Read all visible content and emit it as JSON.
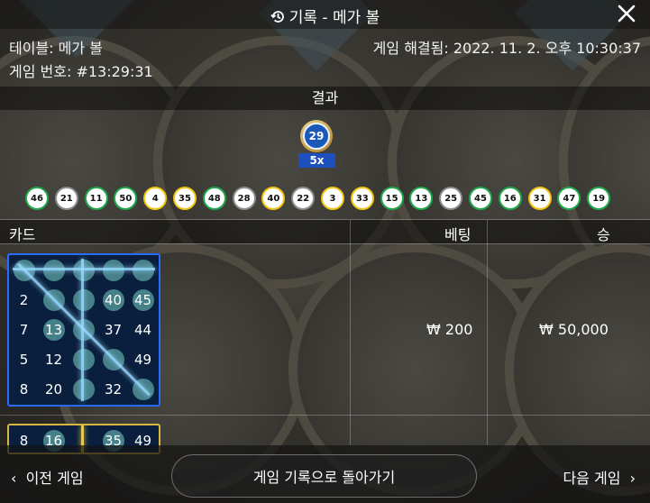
{
  "header": {
    "title": "기록 - 메가 볼",
    "history_icon": "history-icon",
    "close_icon": "close-icon"
  },
  "meta": {
    "table_label": "테이블: 메가 볼",
    "game_number_label": "게임 번호: #13:29:31",
    "resolved_label": "게임 해결됨: 2022. 11. 2. 오후 10:30:37"
  },
  "result": {
    "section_label": "결과",
    "mega_ball": "29",
    "multiplier": "5x",
    "drawn_balls": [
      {
        "n": "46",
        "c": "green"
      },
      {
        "n": "21",
        "c": "gray"
      },
      {
        "n": "11",
        "c": "green"
      },
      {
        "n": "50",
        "c": "green"
      },
      {
        "n": "4",
        "c": "yellow"
      },
      {
        "n": "35",
        "c": "yellow"
      },
      {
        "n": "48",
        "c": "green"
      },
      {
        "n": "28",
        "c": "gray"
      },
      {
        "n": "40",
        "c": "yellow"
      },
      {
        "n": "22",
        "c": "gray"
      },
      {
        "n": "3",
        "c": "yellow"
      },
      {
        "n": "33",
        "c": "yellow"
      },
      {
        "n": "15",
        "c": "green"
      },
      {
        "n": "13",
        "c": "green"
      },
      {
        "n": "25",
        "c": "gray"
      },
      {
        "n": "45",
        "c": "green"
      },
      {
        "n": "16",
        "c": "green"
      },
      {
        "n": "31",
        "c": "yellow"
      },
      {
        "n": "47",
        "c": "green"
      },
      {
        "n": "19",
        "c": "green"
      }
    ]
  },
  "table": {
    "col_card": "카드",
    "col_bet": "베팅",
    "col_win": "승",
    "rows": [
      {
        "bet": "₩ 200",
        "win": "₩ 50,000"
      }
    ]
  },
  "card1": {
    "cells": [
      [
        "",
        "",
        "",
        "",
        ""
      ],
      [
        "2",
        "",
        "",
        "40",
        "45"
      ],
      [
        "7",
        "13",
        "",
        "37",
        "44"
      ],
      [
        "5",
        "12",
        "",
        "",
        "49"
      ],
      [
        "8",
        "20",
        "",
        "32",
        ""
      ]
    ],
    "marked": [
      [
        1,
        1,
        1,
        1,
        1
      ],
      [
        0,
        1,
        1,
        1,
        1
      ],
      [
        0,
        1,
        1,
        0,
        0
      ],
      [
        0,
        0,
        1,
        1,
        0
      ],
      [
        0,
        0,
        1,
        0,
        1
      ]
    ]
  },
  "card2_peek": [
    "8",
    "16",
    "",
    "35",
    "49"
  ],
  "footer": {
    "prev": "이전 게임",
    "back": "게임 기록으로 돌아가기",
    "next": "다음 게임"
  }
}
